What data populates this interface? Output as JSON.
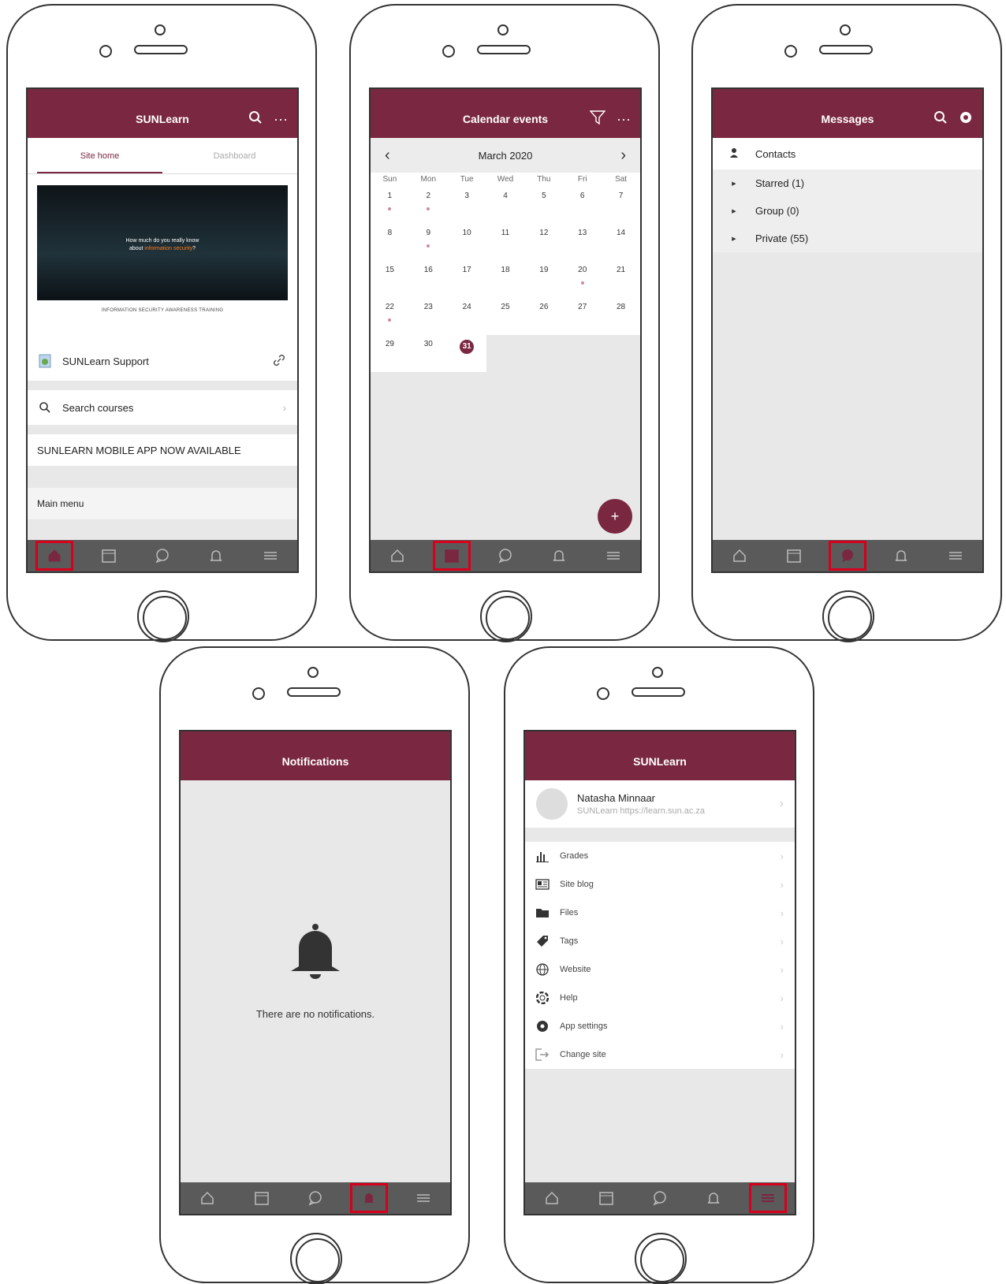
{
  "home": {
    "title": "SUNLearn",
    "tabs": [
      "Site home",
      "Dashboard"
    ],
    "banner_line1": "How much do you really know",
    "banner_line2_prefix": "about ",
    "banner_line2_highlight": "information security",
    "banner_line2_suffix": "?",
    "banner_caption": "INFORMATION SECURITY AWARENESS TRAINING",
    "support_label": "SUNLearn Support",
    "search_label": "Search courses",
    "announcement": "SUNLEARN MOBILE APP NOW AVAILABLE",
    "main_menu": "Main menu"
  },
  "calendar": {
    "title": "Calendar events",
    "month": "March 2020",
    "weekdays": [
      "Sun",
      "Mon",
      "Tue",
      "Wed",
      "Thu",
      "Fri",
      "Sat"
    ],
    "days": [
      "1",
      "2",
      "3",
      "4",
      "5",
      "6",
      "7",
      "8",
      "9",
      "10",
      "11",
      "12",
      "13",
      "14",
      "15",
      "16",
      "17",
      "18",
      "19",
      "20",
      "21",
      "22",
      "23",
      "24",
      "25",
      "26",
      "27",
      "28",
      "29",
      "30",
      "31"
    ],
    "fab": "+"
  },
  "messages": {
    "title": "Messages",
    "contacts": "Contacts",
    "starred": "Starred (1)",
    "group": "Group (0)",
    "private": "Private (55)"
  },
  "notifications": {
    "title": "Notifications",
    "empty": "There are no notifications."
  },
  "more": {
    "title": "SUNLearn",
    "user_name": "Natasha Minnaar",
    "user_site": "SUNLearn https://learn.sun.ac.za",
    "items": [
      "Grades",
      "Site blog",
      "Files",
      "Tags",
      "Website",
      "Help",
      "App settings",
      "Change site"
    ]
  },
  "colors": {
    "brand": "#7a2841",
    "highlight": "#d6001c",
    "tabbar": "#5a5a5a"
  },
  "icons": {
    "tabbar": [
      "home-icon",
      "calendar-icon",
      "messages-icon",
      "bell-icon",
      "menu-icon"
    ],
    "highlighted_tab_per_screen": [
      "home-icon",
      "calendar-icon",
      "messages-icon",
      "bell-icon",
      "menu-icon"
    ]
  }
}
